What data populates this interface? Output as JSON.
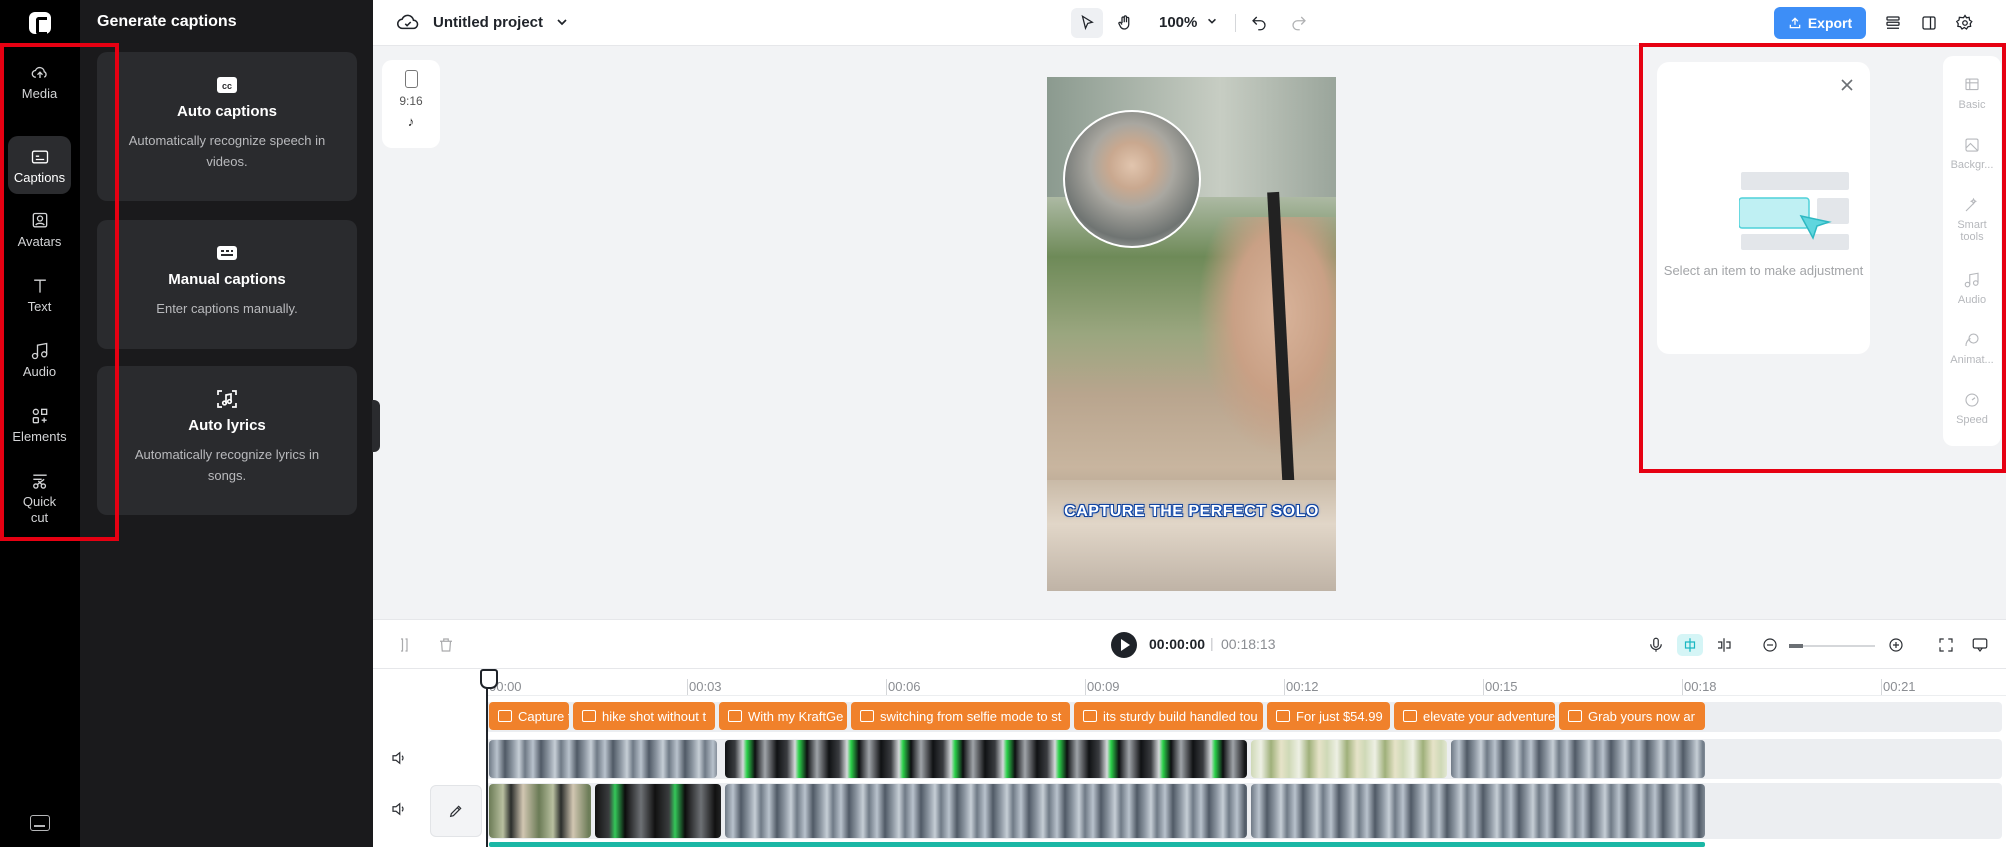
{
  "rail": {
    "items": [
      {
        "label": "Media",
        "icon": "cloud-upload-icon"
      },
      {
        "label": "Captions",
        "icon": "captions-icon",
        "active": true
      },
      {
        "label": "Avatars",
        "icon": "avatar-icon"
      },
      {
        "label": "Text",
        "icon": "text-icon"
      },
      {
        "label": "Audio",
        "icon": "music-note-icon"
      },
      {
        "label": "Elements",
        "icon": "elements-icon"
      },
      {
        "label": "Quick cut",
        "icon": "scissors-icon"
      }
    ]
  },
  "panel": {
    "title": "Generate captions",
    "cards": [
      {
        "title": "Auto captions",
        "desc": "Automatically recognize speech in videos.",
        "icon": "cc-icon"
      },
      {
        "title": "Manual captions",
        "desc": "Enter captions manually.",
        "icon": "keyboard-caption-icon"
      },
      {
        "title": "Auto lyrics",
        "desc": "Automatically recognize lyrics in songs.",
        "icon": "lyrics-icon"
      }
    ]
  },
  "topbar": {
    "project_name": "Untitled project",
    "zoom": "100%",
    "export_label": "Export"
  },
  "canvas": {
    "ratio": "9:16",
    "subtitle": "CAPTURE THE PERFECT SOLO"
  },
  "adjust": {
    "message": "Select an item to make adjustment",
    "tabs": [
      {
        "label": "Basic",
        "icon": "basic-icon"
      },
      {
        "label": "Backgr...",
        "icon": "background-icon"
      },
      {
        "label": "Smart tools",
        "icon": "magic-wand-icon"
      },
      {
        "label": "Audio",
        "icon": "music-note-icon"
      },
      {
        "label": "Animat...",
        "icon": "animation-icon"
      },
      {
        "label": "Speed",
        "icon": "speed-icon"
      }
    ]
  },
  "playback": {
    "current": "00:00:00",
    "separator": "|",
    "total": "00:18:13"
  },
  "timeline": {
    "ticks": [
      "00:00",
      "00:03",
      "00:06",
      "00:09",
      "00:12",
      "00:15",
      "00:18",
      "00:21"
    ],
    "captions": [
      "Capture t",
      "hike shot without t",
      "With my KraftGe",
      "switching from selfie mode to st",
      "its sturdy build handled tou",
      "For just $54.99",
      "elevate your adventure",
      "Grab yours now ar"
    ]
  },
  "colors": {
    "accent": "#3d8ef7",
    "caption_clip": "#f0812b",
    "highlight": "#e60012",
    "audio_strip": "#1bb7a5"
  }
}
